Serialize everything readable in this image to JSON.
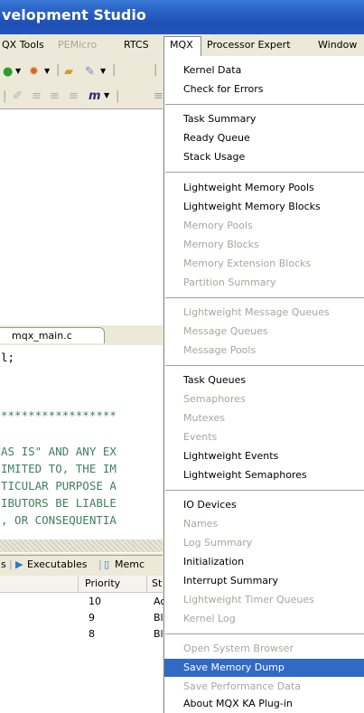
{
  "window": {
    "title": "velopment Studio"
  },
  "menubar": {
    "items": [
      {
        "label": "QX Tools",
        "enabled": true
      },
      {
        "label": "PEMicro",
        "enabled": false
      },
      {
        "label": "RTCS",
        "enabled": true
      },
      {
        "label": "MQX",
        "enabled": true,
        "open": true
      },
      {
        "label": "Processor Expert",
        "enabled": true
      },
      {
        "label": "Window",
        "enabled": true
      }
    ]
  },
  "editor": {
    "tab_label": "mqx_main.c",
    "lines": [
      "l;",
      "*****************",
      "AS IS\" AND ANY EX",
      "IMITED TO, THE IM",
      "TICULAR PURPOSE A",
      "IBUTORS BE LIABLE",
      ", OR CONSEQUENTIA"
    ]
  },
  "bottom_panel": {
    "tabs": [
      "s",
      "Executables",
      "Memc"
    ],
    "columns": [
      "Priority",
      "St"
    ],
    "rows": [
      {
        "priority": "10",
        "state": "Ac"
      },
      {
        "priority": "9",
        "state": "Bl"
      },
      {
        "priority": "8",
        "state": "Bl"
      }
    ]
  },
  "mqx_menu": {
    "groups": [
      [
        {
          "label": "Kernel Data",
          "enabled": true
        },
        {
          "label": "Check for Errors",
          "enabled": true
        }
      ],
      [
        {
          "label": "Task Summary",
          "enabled": true
        },
        {
          "label": "Ready Queue",
          "enabled": true
        },
        {
          "label": "Stack Usage",
          "enabled": true
        }
      ],
      [
        {
          "label": "Lightweight Memory Pools",
          "enabled": true
        },
        {
          "label": "Lightweight Memory Blocks",
          "enabled": true
        },
        {
          "label": "Memory Pools",
          "enabled": false
        },
        {
          "label": "Memory Blocks",
          "enabled": false
        },
        {
          "label": "Memory Extension Blocks",
          "enabled": false
        },
        {
          "label": "Partition Summary",
          "enabled": false
        }
      ],
      [
        {
          "label": "Lightweight Message Queues",
          "enabled": false
        },
        {
          "label": "Message Queues",
          "enabled": false
        },
        {
          "label": "Message Pools",
          "enabled": false
        }
      ],
      [
        {
          "label": "Task Queues",
          "enabled": true
        },
        {
          "label": "Semaphores",
          "enabled": false
        },
        {
          "label": "Mutexes",
          "enabled": false
        },
        {
          "label": "Events",
          "enabled": false
        },
        {
          "label": "Lightweight Events",
          "enabled": true
        },
        {
          "label": "Lightweight Semaphores",
          "enabled": true
        }
      ],
      [
        {
          "label": "IO Devices",
          "enabled": true
        },
        {
          "label": "Names",
          "enabled": false
        },
        {
          "label": "Log Summary",
          "enabled": false
        },
        {
          "label": "Initialization",
          "enabled": true
        },
        {
          "label": "Interrupt Summary",
          "enabled": true
        },
        {
          "label": "Lightweight Timer Queues",
          "enabled": false
        },
        {
          "label": "Kernel Log",
          "enabled": false
        }
      ],
      [
        {
          "label": "Open System Browser",
          "enabled": false
        },
        {
          "label": "Save Memory Dump",
          "enabled": true,
          "selected": true
        },
        {
          "label": "Save Performance Data",
          "enabled": false
        },
        {
          "label": "About MQX KA Plug-in",
          "enabled": true
        }
      ]
    ]
  },
  "colors": {
    "titlebar": "#2c63c8",
    "selection": "#316ac5",
    "comment_green": "#3f7f5f",
    "disabled_text": "#a9a69a",
    "menu_bg": "#ece9d8"
  },
  "icons": [
    "run-icon",
    "debug-icon",
    "open-folder-icon",
    "wand-icon",
    "executables-icon",
    "memory-icon"
  ]
}
